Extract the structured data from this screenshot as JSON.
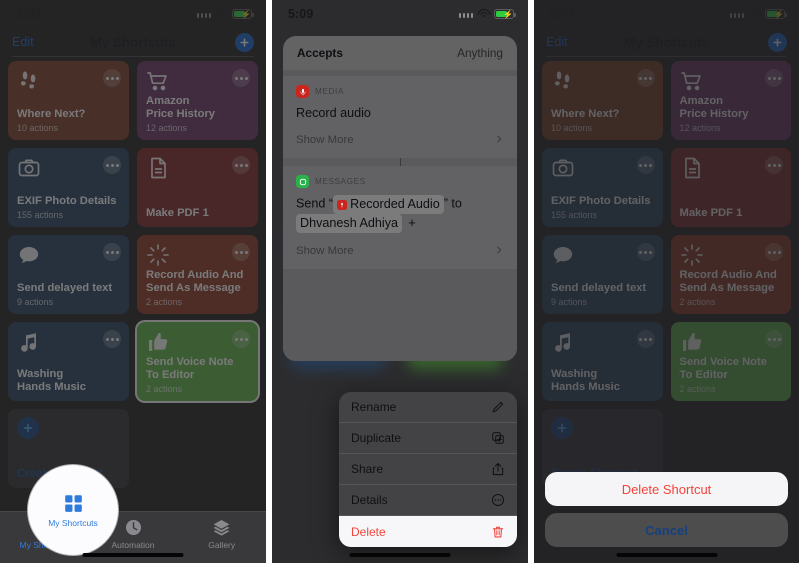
{
  "status_bar": {
    "time": "5:09"
  },
  "nav": {
    "edit_label": "Edit",
    "title": "My Shortcuts",
    "add_icon": "plus-icon"
  },
  "shortcuts": [
    {
      "title": "Where Next?",
      "subtitle": "10 actions",
      "color": "#7c3a22",
      "icon": "footprints-icon"
    },
    {
      "title": "Amazon\nPrice History",
      "title_line1": "Amazon",
      "title_line2": "Price History",
      "subtitle": "12 actions",
      "color": "#6a3160",
      "icon": "shopping-cart-icon"
    },
    {
      "title": "EXIF Photo Details",
      "subtitle": "155 actions",
      "color": "#25405e",
      "icon": "camera-icon"
    },
    {
      "title": "Make PDF 1",
      "subtitle": "",
      "color": "#7e2525",
      "icon": "document-icon"
    },
    {
      "title": "Send delayed text",
      "subtitle": "9 actions",
      "color": "#26415f",
      "icon": "message-bubble-icon"
    },
    {
      "title_line1": "Record Audio And",
      "title_line2": "Send As Message",
      "title": "Record Audio And Send As Message",
      "subtitle": "2 actions",
      "color": "#8b3520",
      "icon": "sparkle-icon"
    },
    {
      "title_line1": "Washing",
      "title_line2": "Hands Music",
      "title": "Washing Hands Music",
      "subtitle": "",
      "color": "#26405e",
      "icon": "music-note-icon"
    },
    {
      "title_line1": "Send Voice Note",
      "title_line2": "To Editor",
      "title": "Send Voice Note To Editor",
      "subtitle": "2 actions",
      "color": "#5cb046",
      "icon": "thumbs-up-icon",
      "selected": true
    }
  ],
  "create_shortcut": {
    "label": "Create Shortcut",
    "icon": "plus-icon"
  },
  "tabs": [
    {
      "label": "My Shortcuts",
      "icon": "grid-squares-icon",
      "active": true
    },
    {
      "label": "Automation",
      "icon": "clock-icon",
      "active": false
    },
    {
      "label": "Gallery",
      "icon": "layers-icon",
      "active": false
    }
  ],
  "preview": {
    "accepts_label": "Accepts",
    "accepts_value": "Anything",
    "actions": [
      {
        "category": "MEDIA",
        "badge_color": "#c8261e",
        "badge_icon": "microphone-icon",
        "title": "Record audio",
        "show_more": "Show More",
        "chevron": "chevron-right-icon"
      },
      {
        "category": "MESSAGES",
        "badge_color": "#29b24a",
        "badge_icon": "message-bubble-icon",
        "title_prefix": "Send “",
        "title_chip": "Recorded Audio",
        "title_mid": "” to",
        "title_recipient": "Dhvanesh Adhiya",
        "title_plus": "+",
        "show_more": "Show More",
        "chevron": "chevron-right-icon"
      }
    ]
  },
  "context_menu": [
    {
      "label": "Rename",
      "icon": "pencil-icon",
      "destructive": false
    },
    {
      "label": "Duplicate",
      "icon": "duplicate-icon",
      "destructive": false
    },
    {
      "label": "Share",
      "icon": "share-icon",
      "destructive": false
    },
    {
      "label": "Details",
      "icon": "ellipsis-circle-icon",
      "destructive": false
    },
    {
      "label": "Delete",
      "icon": "trash-icon",
      "destructive": true
    }
  ],
  "action_sheet": {
    "delete_label": "Delete Shortcut",
    "cancel_label": "Cancel"
  },
  "colors": {
    "accent_blue": "#1463c4",
    "destructive_red": "#f3433a",
    "selected_green": "#5cb046"
  }
}
